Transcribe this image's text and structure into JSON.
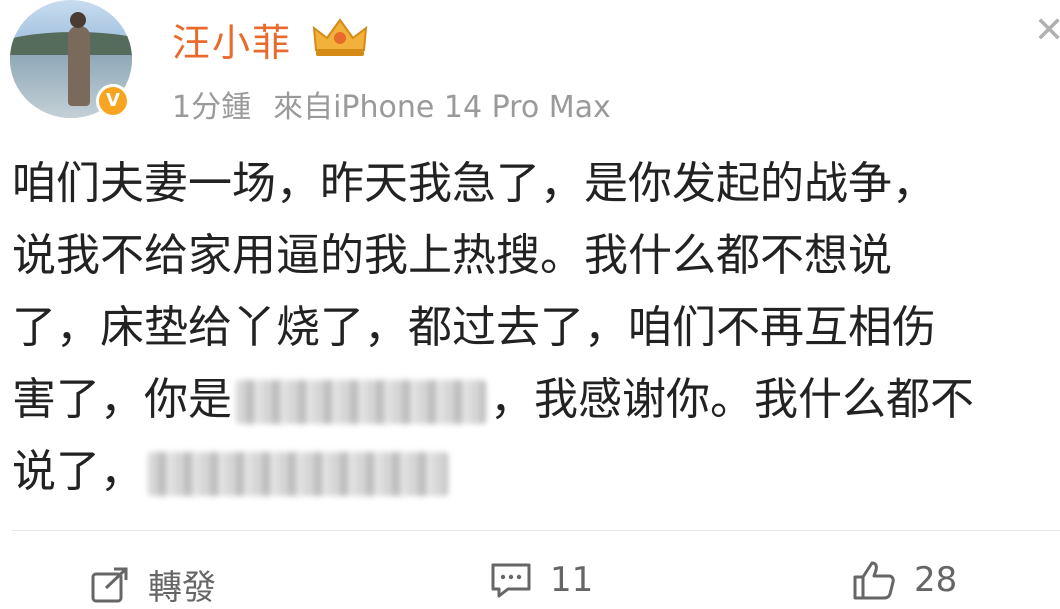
{
  "post": {
    "author": "汪小菲",
    "time": "1分鍾",
    "source": "來自iPhone 14 Pro Max",
    "lines": {
      "l1": "咱们夫妻一场，昨天我急了，是你发起的战争，",
      "l2": "说我不给家用逼的我上热搜。我什么都不想说",
      "l3": "了，床垫给丫烧了，都过去了，咱们不再互相伤",
      "l4a": "害了，你是",
      "l4b": "，我感谢你。我什么都不",
      "l5": "说了，"
    }
  },
  "actions": {
    "repost_label": "轉發",
    "comment_count": "11",
    "like_count": "28"
  },
  "colors": {
    "name": "#e86a2c",
    "badge": "#f7a520",
    "meta": "#9a9a9a"
  }
}
